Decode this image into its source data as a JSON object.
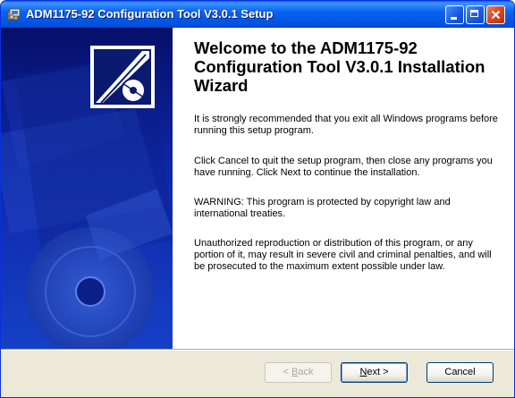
{
  "window": {
    "title": "ADM1175-92 Configuration Tool V3.0.1 Setup"
  },
  "wizard": {
    "heading": "Welcome to the ADM1175-92 Configuration Tool V3.0.1 Installation Wizard",
    "paragraphs": [
      "It is strongly recommended that you exit all Windows programs before running this setup program.",
      "Click Cancel to quit the setup program, then close any programs you have running.  Click Next to continue the installation.",
      "WARNING: This program is protected by copyright law and international treaties.",
      "Unauthorized reproduction or distribution of this program, or any portion of it, may result in severe civil and criminal penalties, and will be prosecuted to the maximum extent possible under law."
    ]
  },
  "buttons": {
    "back": {
      "hotkey": "B",
      "rest": "ack",
      "enabled": false
    },
    "next": {
      "hotkey": "N",
      "rest": "ext >"
    },
    "cancel": "Cancel"
  },
  "colors": {
    "titlebar": "#0a5fe8",
    "left_panel": "#0f27a8",
    "dialog_face": "#ece9d8"
  }
}
